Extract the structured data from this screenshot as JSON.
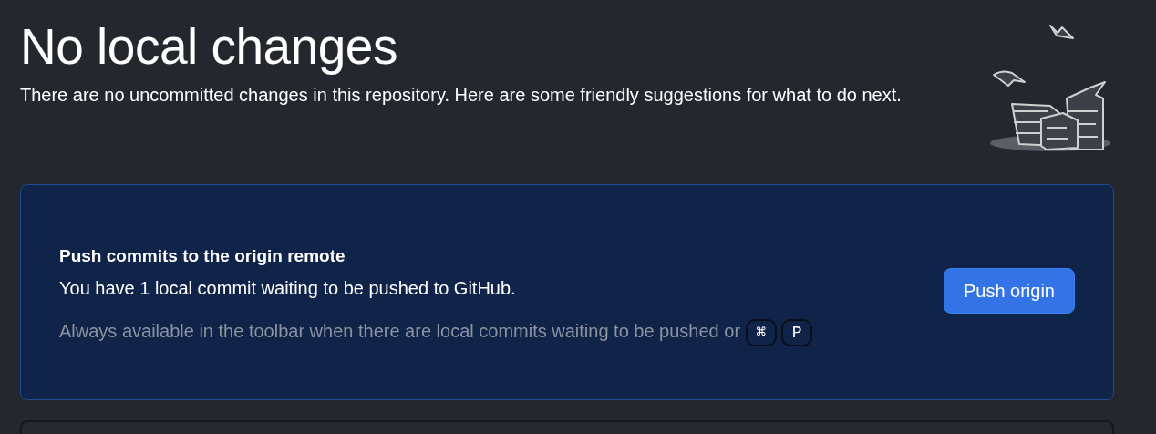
{
  "heading": "No local changes",
  "description": "There are no uncommitted changes in this repository. Here are some friendly suggestions for what to do next.",
  "suggestions": [
    {
      "kind": "push",
      "title": "Push commits to the origin remote",
      "text": "You have 1 local commit waiting to be pushed to GitHub.",
      "hint": "Always available in the toolbar when there are local commits waiting to be pushed or",
      "keys": [
        "⌘",
        "P"
      ],
      "button": "Push origin"
    },
    {
      "kind": "cut"
    }
  ]
}
